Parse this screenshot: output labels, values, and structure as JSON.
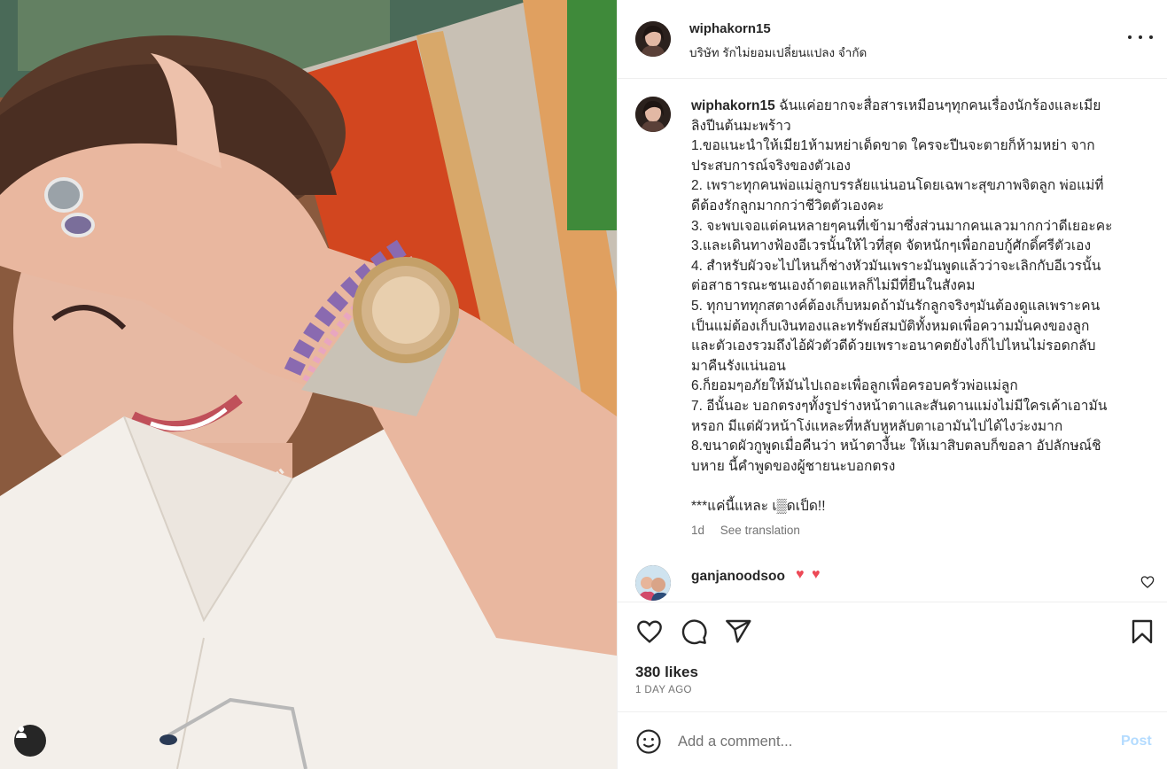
{
  "post": {
    "username": "wiphakorn15",
    "subtitle": "บริษัท รักไม่ยอมเปลี่ยนแปลง จำกัด",
    "caption_first": "ฉันแค่อยากจะสื่อสารเหมือนๆทุกคนเรื่องนักร้องและเมีย",
    "caption_lines": [
      "ลิงปีนต้นมะพร้าว",
      "1.ขอแนะนำให้เมีย1ห้ามหย่าเด็ดขาด ใครจะปีนจะตายก็ห้ามหย่า จาก",
      "ประสบการณ์จริงของตัวเอง",
      "2. เพราะทุกคนพ่อแม่ลูกบรรลัยแน่นอนโดยเฉพาะสุขภาพจิตลูก พ่อแม่ที่",
      "ดีต้องรักลูกมากกว่าชีวิตตัวเองคะ",
      "3. จะพบเจอแต่คนหลายๆคนที่เข้ามาซึ่งส่วนมากคนเลวมากกว่าดีเยอะคะ",
      "3.และเดินทางฟ้องอีเวรนั้นให้ไวที่สุด จัดหนักๆเพื่อกอบกู้ศักดิ์ศรีตัวเอง",
      "4. สำหรับผัวจะไปไหนก็ช่างหัวมันเพราะมันพูดแล้วว่าจะเลิกกับอีเวรนั้น",
      "ต่อสาธารณะชนเองถ้าตอแหลก็ไม่มีที่ยืนในสังคม",
      "5. ทุกบาททุกสตางค์ต้องเก็บหมดถ้ามันรักลูกจริงๆมันต้องดูแลเพราะคน",
      "เป็นแม่ต้องเก็บเงินทองและทรัพย์สมบัติทั้งหมดเพื่อความมั่นคงของลูก",
      "และตัวเองรวมถึงไอ้ผัวตัวดีด้วยเพราะอนาคตยังไงก็ไปไหนไม่รอดกลับ",
      "มาคืนรังแน่นอน",
      "6.ก็ยอมๆอภัยให้มันไปเถอะเพื่อลูกเพื่อครอบครัวพ่อแม่ลูก",
      "7. อีนั้นอะ บอกตรงๆทั้งรูปร่างหน้าตาและสันดานแม่งไม่มีใครเค้าเอามัน",
      "หรอก มีแต่ผัวหน้าโง่แหละที่หลับหูหลับตาเอามันไปได้ไงว่ะงมาก",
      "8.ขนาดผัวกูพูดเมื่อคืนว่า หน้าตางี้นะ ให้เมาสิบตลบก็ขอลา อัปลักษณ์ชิ",
      "บหาย นี้คำพูดของผู้ชายนะบอกตรง",
      "",
      "***แค่นี้แหละ เ▒ดเป็ด!!"
    ],
    "time_ago": "1d",
    "see_translation": "See translation"
  },
  "comment": {
    "username": "ganjanoodsoo",
    "text": "♥ ♥"
  },
  "actions": {
    "likes": "380 likes",
    "date": "1 DAY AGO"
  },
  "add_comment": {
    "placeholder": "Add a comment...",
    "post_label": "Post"
  },
  "colors": {
    "heart": "#ed4956",
    "post_button": "#b3dbff",
    "muted_text": "#737373"
  },
  "icons": [
    "user-tag-icon",
    "more-icon",
    "heart-icon",
    "comment-icon",
    "share-icon",
    "bookmark-icon",
    "emoji-icon"
  ]
}
